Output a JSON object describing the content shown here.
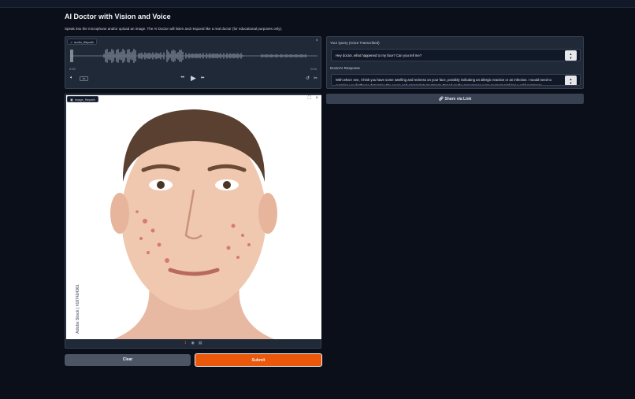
{
  "app": {
    "title": "AI Doctor with Vision and Voice",
    "subtitle": "Speak into the microphone and/or upload an image. The AI Doctor will listen and respond like a real doctor (for educational purposes only)."
  },
  "audio": {
    "label": "audio_filepath",
    "time_current": "0:00",
    "time_total": "0:04",
    "speed": "1x"
  },
  "image": {
    "label": "image_filepath",
    "watermark": "Adobe Stock | #197424361"
  },
  "buttons": {
    "clear": "Clear",
    "submit": "Submit",
    "share": "Share via Link"
  },
  "query": {
    "label": "Your Query (Voice Transcribed)",
    "value": "Hey doctor, what happened to my face? Can you tell me?"
  },
  "response": {
    "label": "Doctor's Response",
    "value": "With what I see, I think you have some swelling and redness on your face, possibly indicating an allergic reaction or an infection. I would need to examine you further to determine the cause and appropriate treatment. Based on the appearance I can suggest applying a cold compress"
  },
  "colors": {
    "background": "#0b0f19",
    "panel": "#1f2937",
    "accent": "#ea580c"
  }
}
